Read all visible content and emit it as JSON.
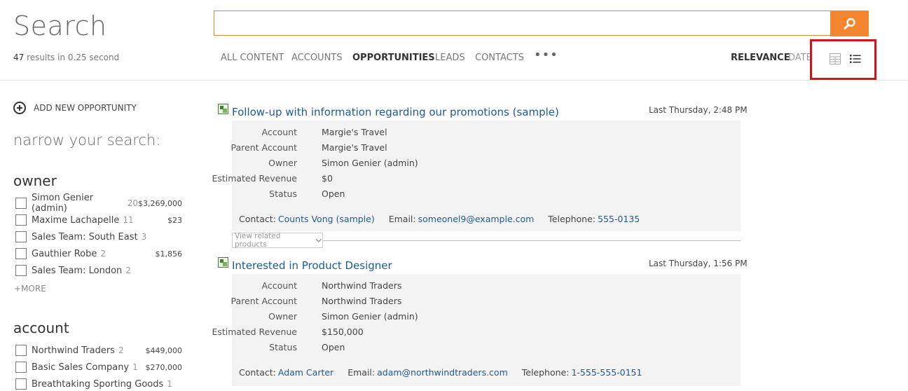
{
  "header": {
    "title": "Search",
    "result_count": "47",
    "result_text": "results",
    "result_time": "in 0.25 second",
    "search_value": ""
  },
  "tabs": [
    "ALL CONTENT",
    "ACCOUNTS",
    "OPPORTUNITIES",
    "LEADS",
    "CONTACTS"
  ],
  "active_tab": "OPPORTUNITIES",
  "more_tabs": "•••",
  "sort": {
    "relevance": "RELEVANCE",
    "date": "DATE"
  },
  "sidebar": {
    "add_new": "ADD NEW OPPORTUNITY",
    "narrow": "narrow your search:",
    "owner": {
      "title": "owner",
      "items": [
        {
          "label": "Simon Genier (admin)",
          "count": "20",
          "amount": "$3,269,000"
        },
        {
          "label": "Maxime Lachapelle",
          "count": "11",
          "amount": "$23"
        },
        {
          "label": "Sales Team: South East",
          "count": "3",
          "amount": ""
        },
        {
          "label": "Gauthier Robe",
          "count": "2",
          "amount": "$1,856"
        },
        {
          "label": "Sales Team: London",
          "count": "2",
          "amount": ""
        }
      ],
      "more": "+MORE"
    },
    "account": {
      "title": "account",
      "items": [
        {
          "label": "Northwind Traders",
          "count": "2",
          "amount": "$449,000"
        },
        {
          "label": "Basic Sales Company",
          "count": "1",
          "amount": "$270,000"
        },
        {
          "label": "Breathtaking Sporting Goods",
          "count": "1",
          "amount": ""
        }
      ]
    }
  },
  "results": [
    {
      "title": "Follow-up with information regarding our promotions (sample)",
      "date": "Last Thursday, 2:48 PM",
      "fields": {
        "account_label": "Account",
        "account": "Margie's Travel",
        "parent_label": "Parent Account",
        "parent": "Margie's Travel",
        "owner_label": "Owner",
        "owner": "Simon Genier (admin)",
        "revenue_label": "Estimated Revenue",
        "revenue": "$0",
        "status_label": "Status",
        "status": "Open"
      },
      "contact_label": "Contact:",
      "contact": "Counts Vong (sample)",
      "email_label": "Email:",
      "email": "someonel9@example.com",
      "phone_label": "Telephone:",
      "phone": "555-0135",
      "related_label": "View related products"
    },
    {
      "title": "Interested in Product Designer",
      "date": "Last Thursday, 1:56 PM",
      "fields": {
        "account_label": "Account",
        "account": "Northwind Traders",
        "parent_label": "Parent Account",
        "parent": "Northwind Traders",
        "owner_label": "Owner",
        "owner": "Simon Genier (admin)",
        "revenue_label": "Estimated Revenue",
        "revenue": "$150,000",
        "status_label": "Status",
        "status": "Open"
      },
      "contact_label": "Contact:",
      "contact": "Adam Carter",
      "email_label": "Email:",
      "email": "adam@northwindtraders.com",
      "phone_label": "Telephone:",
      "phone": "1-555-555-0151"
    }
  ],
  "colors": {
    "accent": "#f5852e",
    "link": "#1e5a96",
    "highlight": "#d0141b"
  }
}
